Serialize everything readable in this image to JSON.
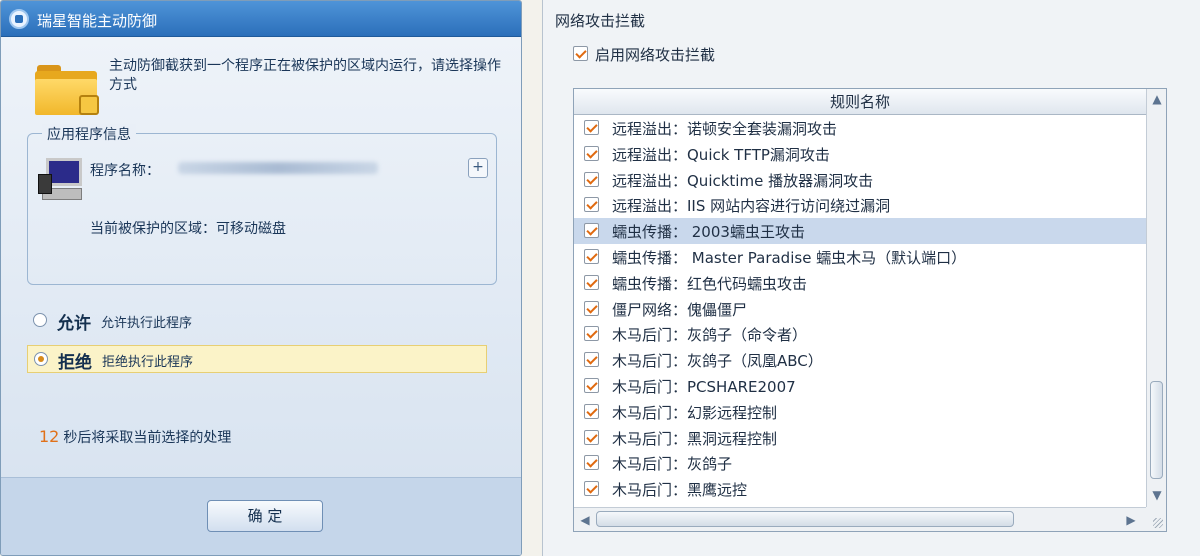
{
  "dialog": {
    "title": "瑞星智能主动防御",
    "message": "主动防御截获到一个程序正在被保护的区域内运行，请选择操作方式",
    "app_info": {
      "legend": "应用程序信息",
      "program_label": "程序名称：",
      "expand_symbol": "+",
      "zone_line": "当前被保护的区域：可移动磁盘"
    },
    "options": [
      {
        "title": "允许",
        "desc": "允许执行此程序",
        "selected": false
      },
      {
        "title": "拒绝",
        "desc": "拒绝执行此程序",
        "selected": true
      }
    ],
    "countdown": {
      "seconds": "12",
      "text": "秒后将采取当前选择的处理"
    },
    "ok_button": "确 定"
  },
  "net": {
    "title": "网络攻击拦截",
    "enable_label": "启用网络攻击拦截",
    "enable_checked": true,
    "column_header": "规则名称",
    "rules": [
      {
        "label": "远程溢出：诺顿安全套装漏洞攻击",
        "checked": true
      },
      {
        "label": "远程溢出：Quick TFTP漏洞攻击",
        "checked": true
      },
      {
        "label": "远程溢出：Quicktime 播放器漏洞攻击",
        "checked": true
      },
      {
        "label": "远程溢出：IIS 网站内容进行访问绕过漏洞",
        "checked": true
      },
      {
        "label": "蠕虫传播： 2003蠕虫王攻击",
        "checked": true,
        "selected": true
      },
      {
        "label": "蠕虫传播： Master Paradise 蠕虫木马（默认端口）",
        "checked": true
      },
      {
        "label": "蠕虫传播：红色代码蠕虫攻击",
        "checked": true
      },
      {
        "label": "僵尸网络：傀儡僵尸",
        "checked": true
      },
      {
        "label": "木马后门：灰鸽子（命令者）",
        "checked": true
      },
      {
        "label": "木马后门：灰鸽子（凤凰ABC）",
        "checked": true
      },
      {
        "label": "木马后门：PCSHARE2007",
        "checked": true
      },
      {
        "label": "木马后门：幻影远程控制",
        "checked": true
      },
      {
        "label": "木马后门：黑洞远程控制",
        "checked": true
      },
      {
        "label": "木马后门：灰鸽子",
        "checked": true
      },
      {
        "label": "木马后门：黑鹰远控",
        "checked": true
      }
    ],
    "scroll_symbols": {
      "up": "▲",
      "down": "▼",
      "left": "◀",
      "right": "▶"
    }
  }
}
